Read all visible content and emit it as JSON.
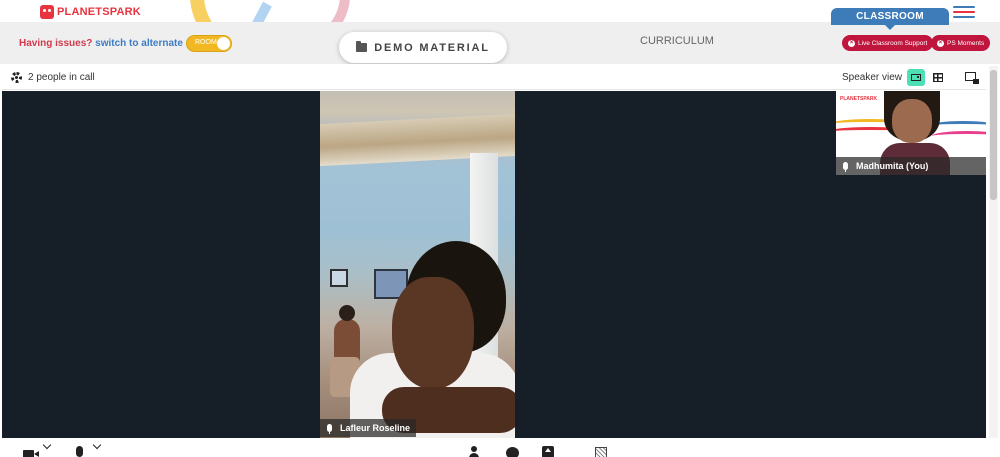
{
  "brand": {
    "logo_text": "PLANETSPARK",
    "primary_color": "#e7343f",
    "accent_blue": "#3d7cb8"
  },
  "header": {
    "issue_text": "Having issues?",
    "issue_link": "switch to alternate room",
    "toggle_label": "ROOM",
    "demo_button": "DEMO MATERIAL",
    "demo_icon": "folder-icon",
    "curriculum": "CURRICULUM",
    "classroom_tab": "CLASSROOM",
    "menu_icon": "hamburger-menu-icon",
    "live_support_button": "Live Classroom Support",
    "ps_moments_button": "PS Moments",
    "pill_color": "#c0153d"
  },
  "call": {
    "settings_icon": "gear-icon",
    "people_count_text": "2 people in call",
    "speaker_view_label": "Speaker view",
    "active_view": "speaker",
    "view_icons": [
      "speaker-view-icon",
      "grid-view-icon",
      "picture-in-picture-icon"
    ],
    "main_participant": {
      "name": "Lafleur Roseline",
      "mic_icon": "microphone-icon"
    },
    "self_participant": {
      "name": "Madhumita (You)",
      "mic_icon": "microphone-icon",
      "tile_logo": "PLANETSPARK"
    }
  },
  "toolbar": {
    "icons": [
      "camera-icon",
      "microphone-icon",
      "participants-icon",
      "chat-icon",
      "screen-share-icon",
      "whiteboard-icon"
    ]
  }
}
